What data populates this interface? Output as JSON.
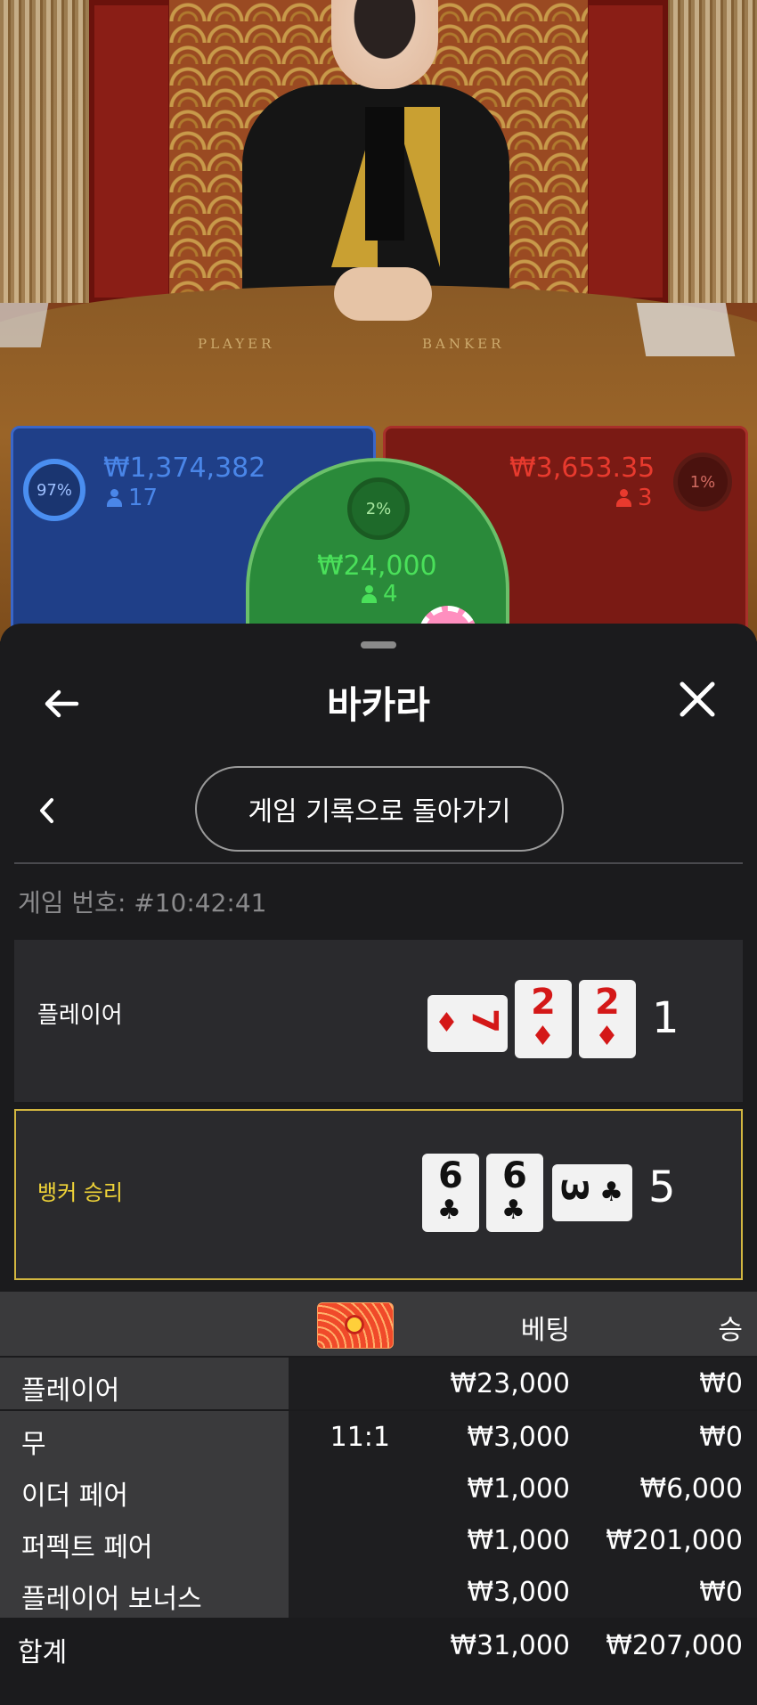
{
  "table": {
    "label_player": "PLAYER",
    "label_banker": "BANKER",
    "player_bet": {
      "percent": "97%",
      "amount": "₩1,374,382",
      "count": "17"
    },
    "tie_bet": {
      "percent": "2%",
      "amount": "₩24,000",
      "count": "4"
    },
    "banker_bet": {
      "percent": "1%",
      "amount": "₩3,653.35",
      "count": "3"
    }
  },
  "sheet": {
    "title": "바카라",
    "history_button": "게임 기록으로 돌아가기",
    "game_number": "게임 번호: #10:42:41"
  },
  "results": {
    "player": {
      "label": "플레이어",
      "score": "1",
      "cards": [
        {
          "rank": "7",
          "suit": "♦",
          "orientation": "sideways"
        },
        {
          "rank": "2",
          "suit": "♦",
          "orientation": "upright"
        },
        {
          "rank": "2",
          "suit": "♦",
          "orientation": "upright"
        }
      ]
    },
    "banker": {
      "label": "뱅커 승리",
      "score": "5",
      "cards": [
        {
          "rank": "6",
          "suit": "♣",
          "orientation": "upright"
        },
        {
          "rank": "6",
          "suit": "♣",
          "orientation": "upright"
        },
        {
          "rank": "3",
          "suit": "♣",
          "orientation": "sideways"
        }
      ]
    }
  },
  "bets": {
    "headers": {
      "bet": "베팅",
      "win": "승"
    },
    "rows": [
      {
        "name": "플레이어",
        "odds": "",
        "bet": "₩23,000",
        "win": "₩0"
      },
      {
        "name": "무",
        "odds": "11:1",
        "bet": "₩3,000",
        "win": "₩0"
      },
      {
        "name": "이더 페어",
        "odds": "",
        "bet": "₩1,000",
        "win": "₩6,000"
      },
      {
        "name": "퍼펙트 페어",
        "odds": "",
        "bet": "₩1,000",
        "win": "₩201,000"
      },
      {
        "name": "플레이어 보너스",
        "odds": "",
        "bet": "₩3,000",
        "win": "₩0"
      }
    ],
    "total": {
      "label": "합계",
      "bet": "₩31,000",
      "win": "₩207,000"
    }
  },
  "colors": {
    "player_blue": "#3a66c8",
    "banker_red": "#a8302a",
    "tie_green": "#6bc06a",
    "winner_border": "#d2b640"
  },
  "icons": [
    "back-arrow-icon",
    "close-icon",
    "chevron-left-icon",
    "person-icon",
    "promo-badge-icon"
  ]
}
